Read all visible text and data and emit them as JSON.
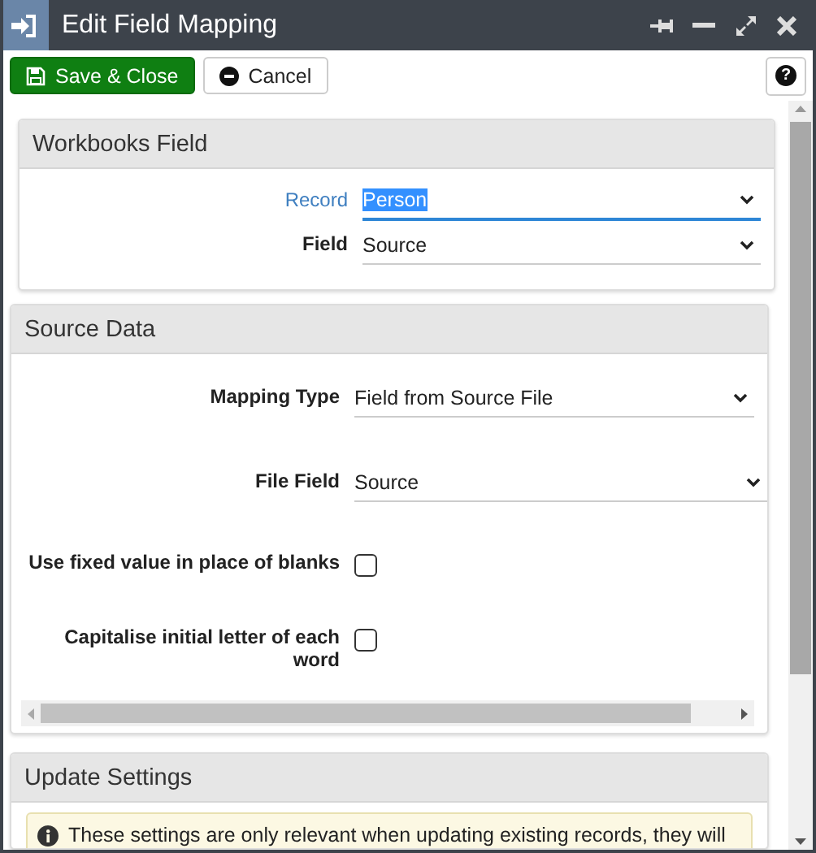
{
  "window": {
    "title": "Edit Field Mapping"
  },
  "toolbar": {
    "buttons": [
      {
        "label": "Save & Close",
        "kind": "primary"
      },
      {
        "label": "Cancel",
        "kind": "secondary"
      }
    ],
    "help": "?"
  },
  "panels": [
    {
      "title": "Workbooks Field",
      "rows": [
        {
          "kind": "select",
          "label": "Record",
          "value": "Person",
          "focused": true
        },
        {
          "kind": "select",
          "label": "Field",
          "value": "Source",
          "focused": false
        }
      ]
    },
    {
      "title": "Source Data",
      "horizontal_scrollbar": true,
      "rows": [
        {
          "kind": "select",
          "label": "Mapping Type",
          "value": "Field from Source File",
          "focused": false
        },
        {
          "kind": "select",
          "label": "File Field",
          "value": "Source",
          "focused": false
        },
        {
          "kind": "checkbox",
          "label": "Use fixed value in place of blanks",
          "checked": false
        },
        {
          "kind": "checkbox",
          "label": "Capitalise initial letter of each word",
          "checked": false
        }
      ]
    },
    {
      "title": "Update Settings",
      "notice": "These settings are only relevant when updating existing records, they will"
    }
  ]
}
